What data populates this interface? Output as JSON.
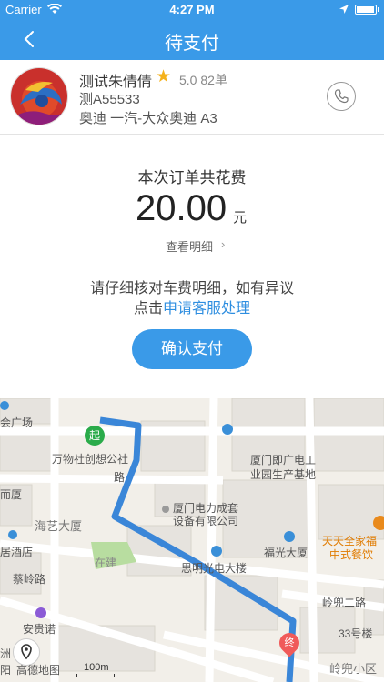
{
  "status_bar": {
    "carrier": "Carrier",
    "time": "4:27 PM"
  },
  "nav": {
    "title": "待支付",
    "back_icon": "chevron-left-icon"
  },
  "driver": {
    "name": "测试朱倩倩",
    "rating": "5.0 82单",
    "plate": "测A55533",
    "car_model": "奥迪 一汽-大众奥迪 A3"
  },
  "fee": {
    "caption": "本次订单共花费",
    "amount": "20.00",
    "unit": "元",
    "detail_link": "查看明细",
    "notice_line1": "请仔细核对车费明细，如有异议",
    "notice_prefix": "点击",
    "service_link": "申请客服处理",
    "confirm_button": "确认支付"
  },
  "map": {
    "labels": {
      "plaza": "会广场",
      "wanwu": "万物社创想公社",
      "lu": "路",
      "xiamen_mansion": "而厦",
      "haiyi": "海艺大厦",
      "hotel": "居酒店",
      "cailing": "蔡岭路",
      "anmei": "安贵诺",
      "xiamen_power": "厦门电力成套",
      "xiamen_power2": "设备有限公司",
      "huli": "思明光电大楼",
      "industry": "厦门即广电工",
      "industry2": "业园生产基地",
      "fuguang": "福光大厦",
      "restaurant": "天天全家福",
      "restaurant2": "中式餐饮",
      "linghou": "岭兜二路",
      "no33": "33号楼",
      "linghou_area": "岭兜小区",
      "zaijian": "在建",
      "zhou": "洲",
      "yang": "阳"
    },
    "start_marker": "起",
    "end_marker": "终",
    "logo": "高德地图",
    "scale": "100m"
  },
  "colors": {
    "accent": "#3a9ae8",
    "route": "#3a86d8",
    "star": "#f5b21b",
    "link": "#2e8ee0"
  }
}
